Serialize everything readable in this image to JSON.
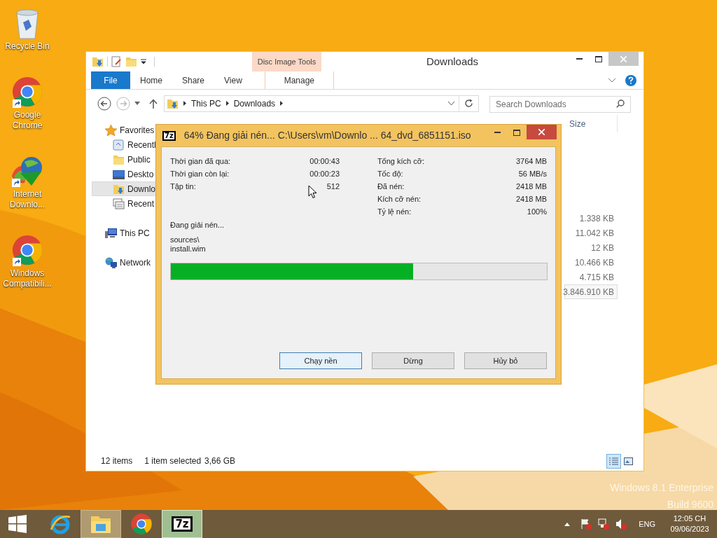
{
  "desktop": {
    "icons": [
      {
        "kind": "recycle-bin",
        "label": "Recycle Bin"
      },
      {
        "kind": "chrome",
        "label": "Google Chrome"
      },
      {
        "kind": "downloader",
        "label": "Internet Downlo..."
      },
      {
        "kind": "chrome",
        "label": "Windows Compatibili..."
      }
    ],
    "edition": [
      "Windows 8.1 Enterprise",
      "Build 9600"
    ]
  },
  "explorer": {
    "title": "Downloads",
    "context_group": "Disc Image Tools",
    "tabs": [
      {
        "label": "File",
        "kind": "file",
        "selected": false
      },
      {
        "label": "Home",
        "kind": "plain",
        "selected": false
      },
      {
        "label": "Share",
        "kind": "plain",
        "selected": false
      },
      {
        "label": "View",
        "kind": "plain",
        "selected": false
      },
      {
        "label": "Manage",
        "kind": "context",
        "selected": false
      }
    ],
    "breadcrumb": [
      "This PC",
      "Downloads"
    ],
    "search": {
      "placeholder": "Search Downloads"
    },
    "nav": [
      {
        "label": "Favorites",
        "kind": "star",
        "selected": false,
        "children": [
          {
            "label": "Recentl",
            "kind": "recent",
            "selected": false
          },
          {
            "label": "Public",
            "kind": "folder",
            "selected": false
          },
          {
            "label": "Deskto",
            "kind": "desktop",
            "selected": false
          },
          {
            "label": "Downlo",
            "kind": "downloads",
            "selected": true
          },
          {
            "label": "Recent",
            "kind": "places",
            "selected": false
          }
        ]
      },
      {
        "label": "This PC",
        "kind": "pc",
        "selected": false
      },
      {
        "label": "Network",
        "kind": "network",
        "selected": false
      }
    ],
    "size_header": "Size",
    "sizes": [
      {
        "value": "1.338 KB",
        "selected": false
      },
      {
        "value": "11.042 KB",
        "selected": false
      },
      {
        "value": "12 KB",
        "selected": false
      },
      {
        "value": "10.466 KB",
        "selected": false
      },
      {
        "value": "4.715 KB",
        "selected": false
      },
      {
        "value": "3.846.910 KB",
        "selected": true
      }
    ],
    "status": {
      "count": "12 items",
      "selection": "1 item selected",
      "selection_size": "3,66 GB"
    },
    "views": [
      {
        "kind": "details",
        "selected": true
      },
      {
        "kind": "large-icons",
        "selected": false
      }
    ]
  },
  "dialog": {
    "app_icon": "7z",
    "title": "64% Đang giải nén... C:\\Users\\vm\\Downlo ... 64_dvd_6851151.iso",
    "stats_left": [
      {
        "label": "Thời gian đã qua:",
        "value": "00:00:43"
      },
      {
        "label": "Thời gian còn lại:",
        "value": "00:00:23"
      },
      {
        "label": "Tập tin:",
        "value": "512"
      }
    ],
    "stats_right": [
      {
        "label": "Tổng kích cỡ:",
        "value": "3764 MB"
      },
      {
        "label": "Tốc độ:",
        "value": "56 MB/s"
      },
      {
        "label": "Đã nén:",
        "value": "2418 MB"
      },
      {
        "label": "Kích cỡ nén:",
        "value": "2418 MB"
      },
      {
        "label": "Tỷ lệ nén:",
        "value": "100%"
      }
    ],
    "status": "Đang giải nén...",
    "path": [
      "sources\\",
      "install.wim"
    ],
    "progress": {
      "level": 0.645
    },
    "buttons": [
      {
        "label": "Chạy nền",
        "default": true
      },
      {
        "label": "Dừng",
        "default": false
      },
      {
        "label": "Hủy bỏ",
        "default": false
      }
    ]
  },
  "taskbar": {
    "apps": [
      {
        "kind": "ie",
        "active": false
      },
      {
        "kind": "explorer",
        "active": true
      },
      {
        "kind": "chrome",
        "active": false
      },
      {
        "kind": "archiver",
        "active": true,
        "label": "7z"
      }
    ],
    "language": "ENG",
    "time": "12:05 CH",
    "date": "09/06/2023"
  }
}
